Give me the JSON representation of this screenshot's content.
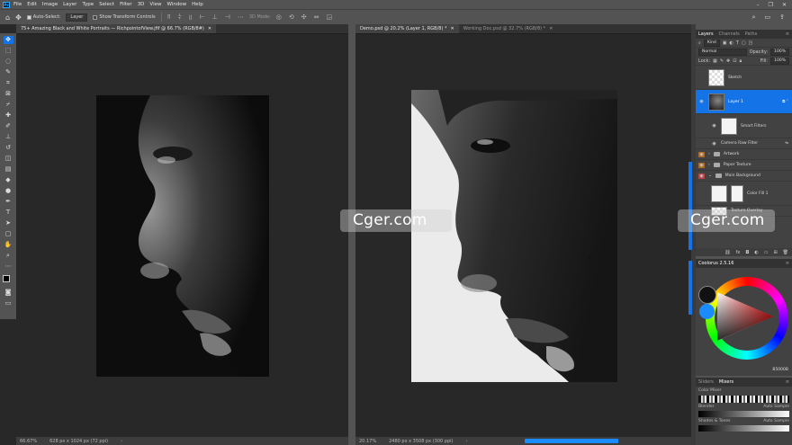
{
  "menubar": {
    "app_logo": "Ps",
    "items": [
      "File",
      "Edit",
      "Image",
      "Layer",
      "Type",
      "Select",
      "Filter",
      "3D",
      "View",
      "Window",
      "Help"
    ]
  },
  "options": {
    "auto_select_label": "Auto-Select:",
    "auto_select_value": "Layer",
    "show_transform_label": "Show Transform Controls",
    "mode_3d_label": "3D Mode:"
  },
  "doc1": {
    "tab_label": "75+ Amazing Black and White Portraits — RichpointofView.jfif @ 66.7% (RGB/8#)",
    "zoom": "66.67%",
    "size_info": "628 px x 1024 px (72 ppi)"
  },
  "doc2": {
    "tabs": [
      {
        "label": "Demo.psd @ 20.2% (Layer 1, RGB/8) *"
      },
      {
        "label": "Working Doc.psd @ 32.7% (RGB/8) *"
      }
    ],
    "zoom": "20.17%",
    "size_info": "2480 px x 3508 px (300 ppi)"
  },
  "watermarks": [
    "Cger.com",
    "Cger.com"
  ],
  "layers_panel": {
    "tabs": [
      "Layers",
      "Channels",
      "Paths"
    ],
    "kind_label": "Kind",
    "blend_mode": "Normal",
    "opacity_label": "Opacity:",
    "opacity_value": "100%",
    "lock_label": "Lock:",
    "fill_label": "Fill:",
    "fill_value": "100%",
    "layers": [
      {
        "name": "Sketch"
      },
      {
        "name": "Layer 1"
      },
      {
        "name": "Smart Filters"
      },
      {
        "name": "Camera Raw Filter"
      },
      {
        "name": "Artwork"
      },
      {
        "name": "Paper Texture"
      },
      {
        "name": "Main Background"
      },
      {
        "name": "Color Fill 1"
      },
      {
        "name": "Texture Overlay"
      }
    ]
  },
  "coolorus": {
    "title": "Coolorus 2.5.16",
    "hex_value": "B5000B",
    "colors": {
      "foreground": "#111111",
      "background": "#1a8cff",
      "accent": "#1473e6"
    }
  },
  "mixers_panel": {
    "tabs": [
      "Sliders",
      "Mixers"
    ],
    "row1_label": "Color Mixer",
    "row2_left": "Blender",
    "row2_right": "Auto Sample",
    "row3_left": "Shades & Tones",
    "row3_right": "Auto Sample"
  }
}
